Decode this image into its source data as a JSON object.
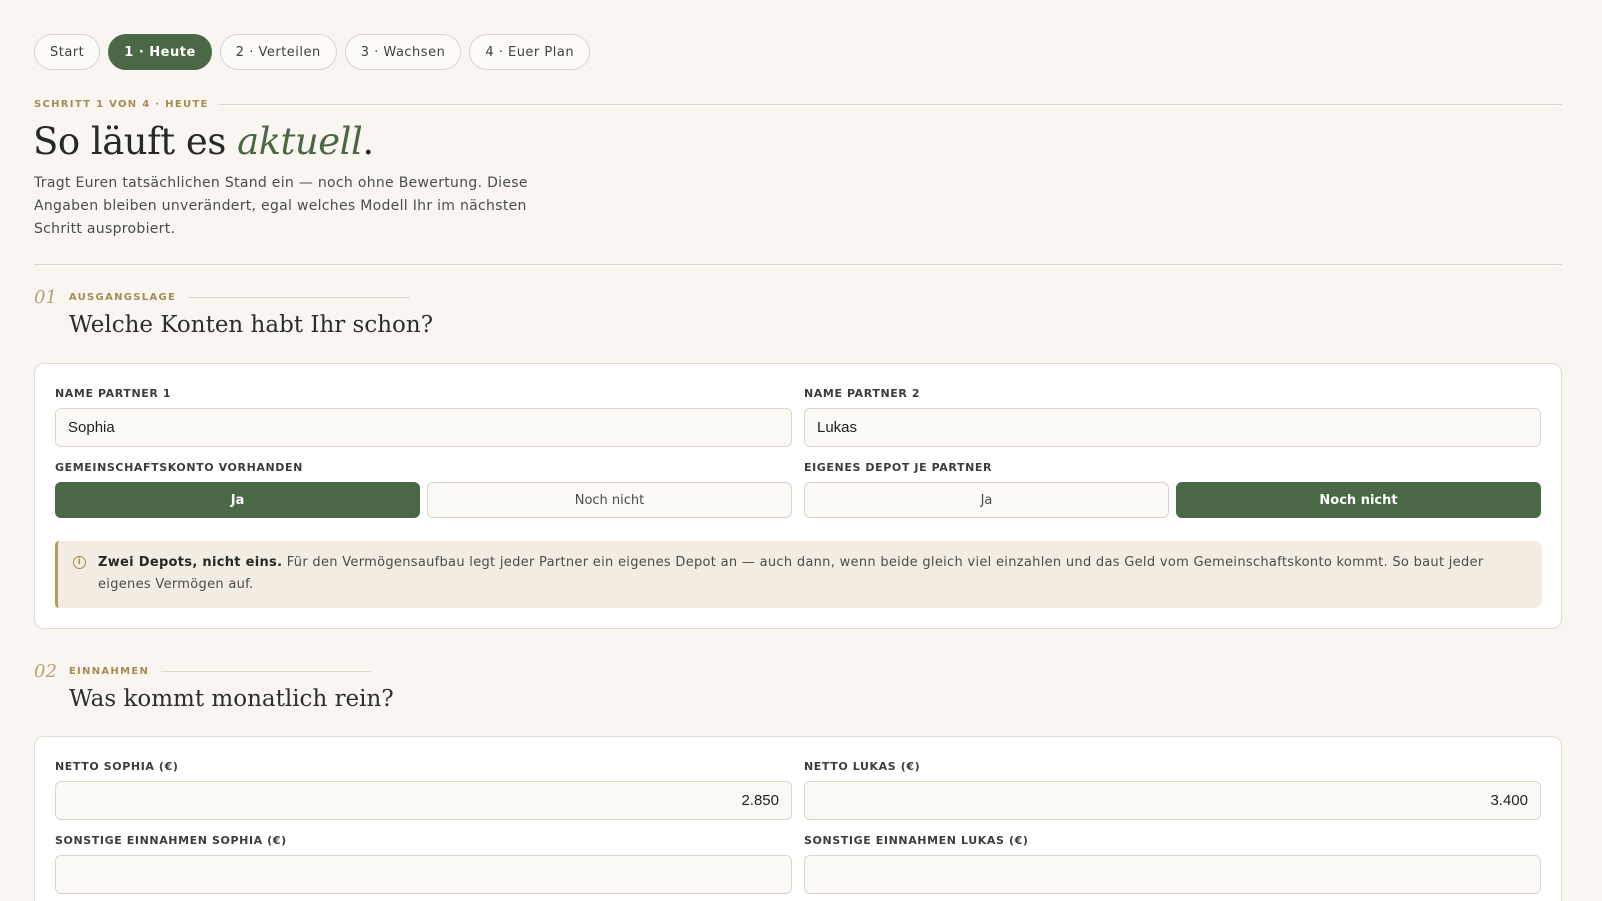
{
  "tabs": [
    "Start",
    "1 · Heute",
    "2 · Verteilen",
    "3 · Wachsen",
    "4 · Euer Plan"
  ],
  "active_tab": "1 · Heute",
  "step": {
    "label": "SCHRITT 1 VON 4 · HEUTE",
    "title_main": "So läuft es ",
    "title_accent": "aktuell",
    "title_end": ".",
    "description": "Tragt Euren tatsächlichen Stand ein — noch ohne Bewertung. Diese Angaben bleiben unverändert, egal welches Modell Ihr im nächsten Schritt ausprobiert."
  },
  "section1": {
    "number": "01",
    "kicker": "AUSGANGSLAGE",
    "title": "Welche Konten habt Ihr schon?",
    "name1_label": "NAME PARTNER 1",
    "name1_value": "Sophia",
    "name2_label": "NAME PARTNER 2",
    "name2_value": "Lukas",
    "joint_label": "GEMEINSCHAFTSKONTO VORHANDEN",
    "joint_options": [
      "Ja",
      "Noch nicht"
    ],
    "joint_selected": "Ja",
    "depot_label": "EIGENES DEPOT JE PARTNER",
    "depot_options": [
      "Ja",
      "Noch nicht"
    ],
    "depot_selected": "Noch nicht",
    "info_icon": "info-circle-icon",
    "info_bold": "Zwei Depots, nicht eins.",
    "info_text": " Für den Vermögensaufbau legt jeder Partner ein eigenes Depot an — auch dann, wenn beide gleich viel einzahlen und das Geld vom Gemeinschaftskonto kommt. So baut jeder eigenes Vermögen auf."
  },
  "section2": {
    "number": "02",
    "kicker": "EINNAHMEN",
    "title": "Was kommt monatlich rein?",
    "net1_label": "NETTO SOPHIA (€)",
    "net1_value": "2.850",
    "net2_label": "NETTO LUKAS (€)",
    "net2_value": "3.400",
    "other1_label": "SONSTIGE EINNAHMEN SOPHIA (€)",
    "other1_value": "",
    "other2_label": "SONSTIGE EINNAHMEN LUKAS (€)",
    "other2_value": ""
  },
  "colors": {
    "accent": "#4b6846",
    "gold": "#a88a52",
    "background": "#f9f6f1"
  }
}
